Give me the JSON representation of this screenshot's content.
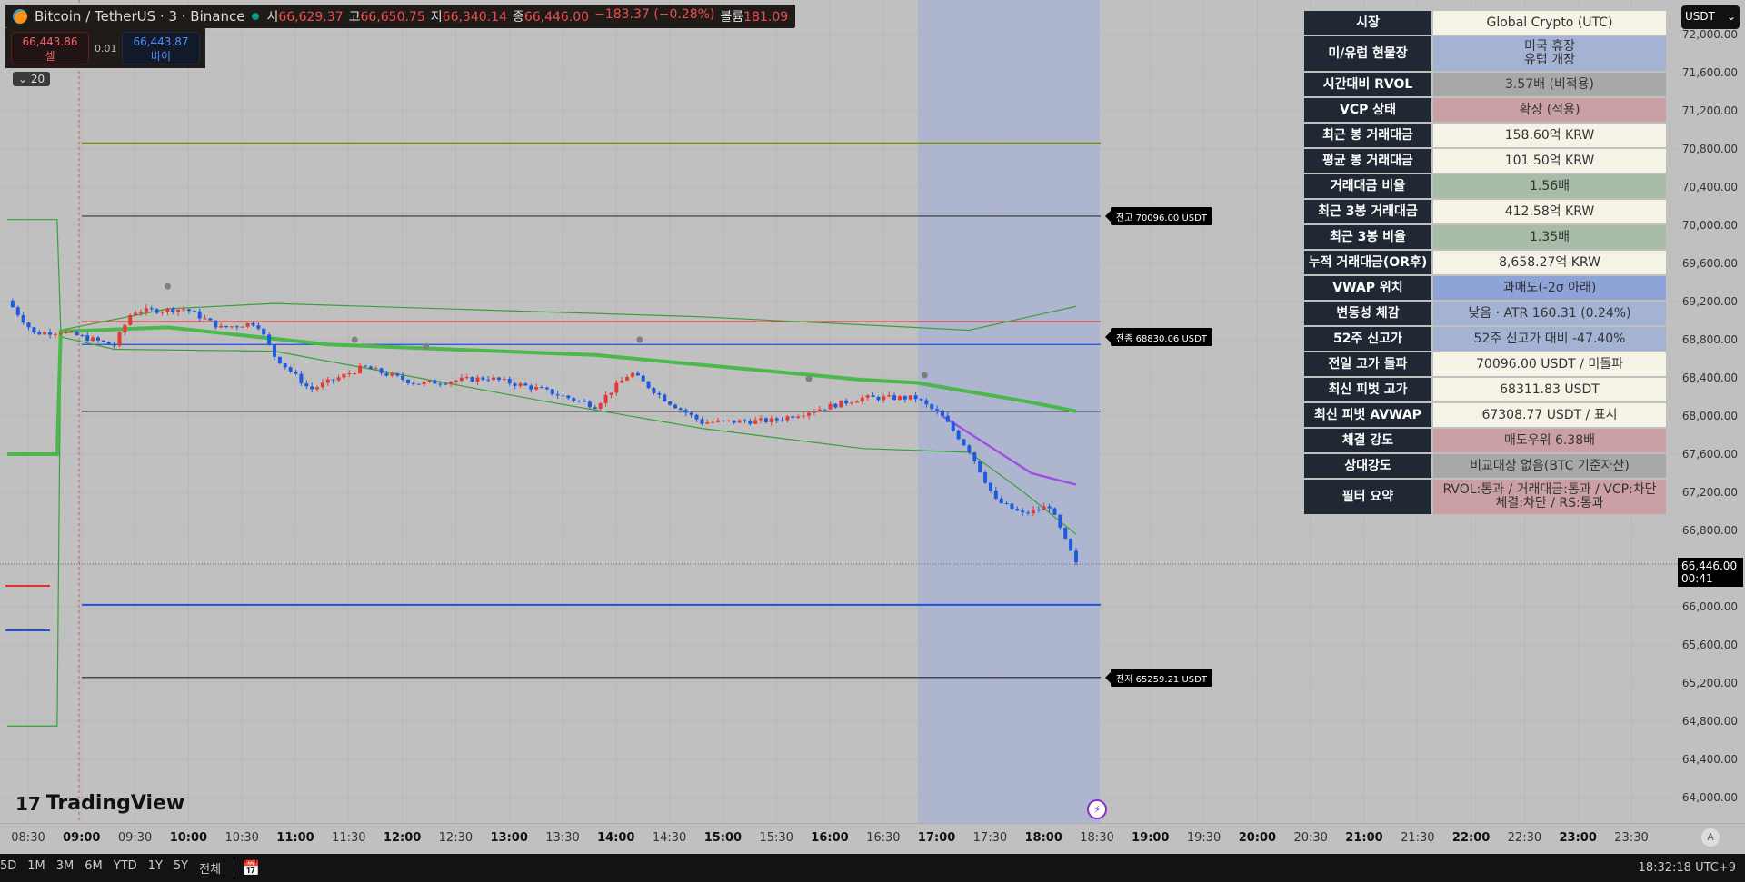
{
  "header": {
    "symbol": "Bitcoin / TetherUS · 3 · Binance",
    "o_label": "시",
    "o": "66,629.37",
    "h_label": "고",
    "h": "66,650.75",
    "l_label": "저",
    "l": "66,340.14",
    "c_label": "종",
    "c": "66,446.00",
    "change": "−183.37 (−0.28%)",
    "vol_label": "볼륨",
    "vol": "181.09"
  },
  "trade": {
    "sell_price": "66,443.86",
    "sell_label": "셀",
    "spread": "0.01",
    "buy_price": "66,443.87",
    "buy_label": "바이"
  },
  "collapse_label": "20",
  "currency": "USDT",
  "table": [
    {
      "k": "시장",
      "v": "Global Crypto (UTC)",
      "color": "#f5f2e6"
    },
    {
      "k": "미/유럽 현물장",
      "v": "미국 휴장\n유럽 개장",
      "color": "#a4b2d4"
    },
    {
      "k": "시간대비 RVOL",
      "v": "3.57배 (비적용)",
      "color": "#a8a8a8"
    },
    {
      "k": "VCP 상태",
      "v": "확장 (적용)",
      "color": "#cba0a4"
    },
    {
      "k": "최근 봉 거래대금",
      "v": "158.60억 KRW",
      "color": "#f5f2e6"
    },
    {
      "k": "평균 봉 거래대금",
      "v": "101.50억 KRW",
      "color": "#f5f2e6"
    },
    {
      "k": "거래대금 비율",
      "v": "1.56배",
      "color": "#a8bca8"
    },
    {
      "k": "최근 3봉 거래대금",
      "v": "412.58억 KRW",
      "color": "#f5f2e6"
    },
    {
      "k": "최근 3봉 비율",
      "v": "1.35배",
      "color": "#a8bca8"
    },
    {
      "k": "누적 거래대금(OR후)",
      "v": "8,658.27억 KRW",
      "color": "#f5f2e6"
    },
    {
      "k": "VWAP 위치",
      "v": "과매도(-2σ 아래)",
      "color": "#8ea3d8"
    },
    {
      "k": "변동성 체감",
      "v": "낮음 · ATR 160.31 (0.24%)",
      "color": "#a4b2d4"
    },
    {
      "k": "52주 신고가",
      "v": "52주 신고가 대비 -47.40%",
      "color": "#a4b2d4"
    },
    {
      "k": "전일 고가 돌파",
      "v": "70096.00 USDT / 미돌파",
      "color": "#f5f2e6"
    },
    {
      "k": "최신 피벗 고가",
      "v": "68311.83 USDT",
      "color": "#f5f2e6"
    },
    {
      "k": "최신 피벗 AVWAP",
      "v": "67308.77 USDT / 표시",
      "color": "#f5f2e6"
    },
    {
      "k": "체결 강도",
      "v": "매도우위 6.38배",
      "color": "#cba0a4"
    },
    {
      "k": "상대강도",
      "v": "비교대상 없음(BTC 기준자산)",
      "color": "#a8a8a8"
    },
    {
      "k": "필터 요약",
      "v": "RVOL:통과 / 거래대금:통과 / VCP:차단\n체결:차단 / RS:통과",
      "color": "#cba0a4"
    }
  ],
  "price_axis": [
    "72,000.00",
    "71,600.00",
    "71,200.00",
    "70,800.00",
    "70,400.00",
    "70,000.00",
    "69,600.00",
    "69,200.00",
    "68,800.00",
    "68,400.00",
    "68,000.00",
    "67,600.00",
    "67,200.00",
    "66,800.00",
    "66,000.00",
    "65,600.00",
    "65,200.00",
    "64,800.00",
    "64,400.00",
    "64,000.00"
  ],
  "current_price": {
    "price": "66,446.00",
    "countdown": "00:41"
  },
  "levels": [
    {
      "label": "전고 70096.00 USDT",
      "price": 70096
    },
    {
      "label": "전종 68830.06 USDT",
      "price": 68830.06
    },
    {
      "label": "전저 65259.21 USDT",
      "price": 65259.21
    }
  ],
  "time_axis": [
    "08:30",
    "09:00",
    "09:30",
    "10:00",
    "10:30",
    "11:00",
    "11:30",
    "12:00",
    "12:30",
    "13:00",
    "13:30",
    "14:00",
    "14:30",
    "15:00",
    "15:30",
    "16:00",
    "16:30",
    "17:00",
    "17:30",
    "18:00",
    "18:30",
    "19:00",
    "19:30",
    "20:00",
    "20:30",
    "21:00",
    "21:30",
    "22:00",
    "22:30",
    "23:00",
    "23:30"
  ],
  "ranges": [
    "5D",
    "1M",
    "3M",
    "6M",
    "YTD",
    "1Y",
    "5Y",
    "전체"
  ],
  "clock": "18:32:18 UTC+9",
  "logo": "TradingView",
  "auto_label": "A",
  "chart_data": {
    "type": "candlestick",
    "price_path": [
      [
        0,
        69210
      ],
      [
        15,
        68867
      ],
      [
        30,
        68886
      ],
      [
        60,
        68743
      ],
      [
        70,
        69095
      ],
      [
        100,
        69124
      ],
      [
        120,
        68924
      ],
      [
        140,
        68980
      ],
      [
        150,
        68629
      ],
      [
        170,
        68276
      ],
      [
        200,
        68514
      ],
      [
        230,
        68340
      ],
      [
        270,
        68400
      ],
      [
        300,
        68276
      ],
      [
        330,
        68105
      ],
      [
        350,
        68457
      ],
      [
        370,
        68162
      ],
      [
        390,
        67933
      ],
      [
        430,
        67952
      ],
      [
        450,
        68048
      ],
      [
        480,
        68190
      ],
      [
        510,
        68190
      ],
      [
        525,
        67990
      ],
      [
        540,
        67638
      ],
      [
        555,
        67114
      ],
      [
        570,
        66971
      ],
      [
        585,
        67057
      ],
      [
        600,
        66446
      ]
    ],
    "vwap": [
      [
        0,
        67600
      ],
      [
        28,
        67600
      ],
      [
        30,
        68886
      ],
      [
        90,
        68930
      ],
      [
        180,
        68750
      ],
      [
        330,
        68640
      ],
      [
        480,
        68380
      ],
      [
        510,
        68350
      ],
      [
        570,
        68160
      ],
      [
        600,
        68050
      ]
    ],
    "upper_band": [
      [
        0,
        70060
      ],
      [
        28,
        70060
      ],
      [
        30,
        68900
      ],
      [
        90,
        69124
      ],
      [
        150,
        69180
      ],
      [
        390,
        69040
      ],
      [
        540,
        68900
      ],
      [
        600,
        69150
      ]
    ],
    "lower_band": [
      [
        0,
        64750
      ],
      [
        28,
        64750
      ],
      [
        30,
        68830
      ],
      [
        60,
        68700
      ],
      [
        150,
        68680
      ],
      [
        300,
        68160
      ],
      [
        390,
        67870
      ],
      [
        480,
        67660
      ],
      [
        540,
        67620
      ],
      [
        570,
        67210
      ],
      [
        600,
        66760
      ]
    ],
    "avwap": [
      [
        525,
        68000
      ],
      [
        550,
        67700
      ],
      [
        575,
        67400
      ],
      [
        600,
        67280
      ]
    ],
    "hlines": [
      {
        "price": 70860,
        "color": "#7a8a10"
      },
      {
        "price": 70096,
        "color": "#333"
      },
      {
        "price": 68990,
        "color": "#e03030"
      },
      {
        "price": 68750,
        "color": "#2050e0"
      },
      {
        "price": 68050,
        "color": "#111"
      },
      {
        "price": 66020,
        "color": "#2050e0"
      },
      {
        "price": 65259.21,
        "color": "#333"
      }
    ],
    "pivots": [
      [
        90,
        69360
      ],
      [
        195,
        68800
      ],
      [
        235,
        68730
      ],
      [
        355,
        68800
      ],
      [
        450,
        68390
      ],
      [
        515,
        68430
      ]
    ]
  }
}
